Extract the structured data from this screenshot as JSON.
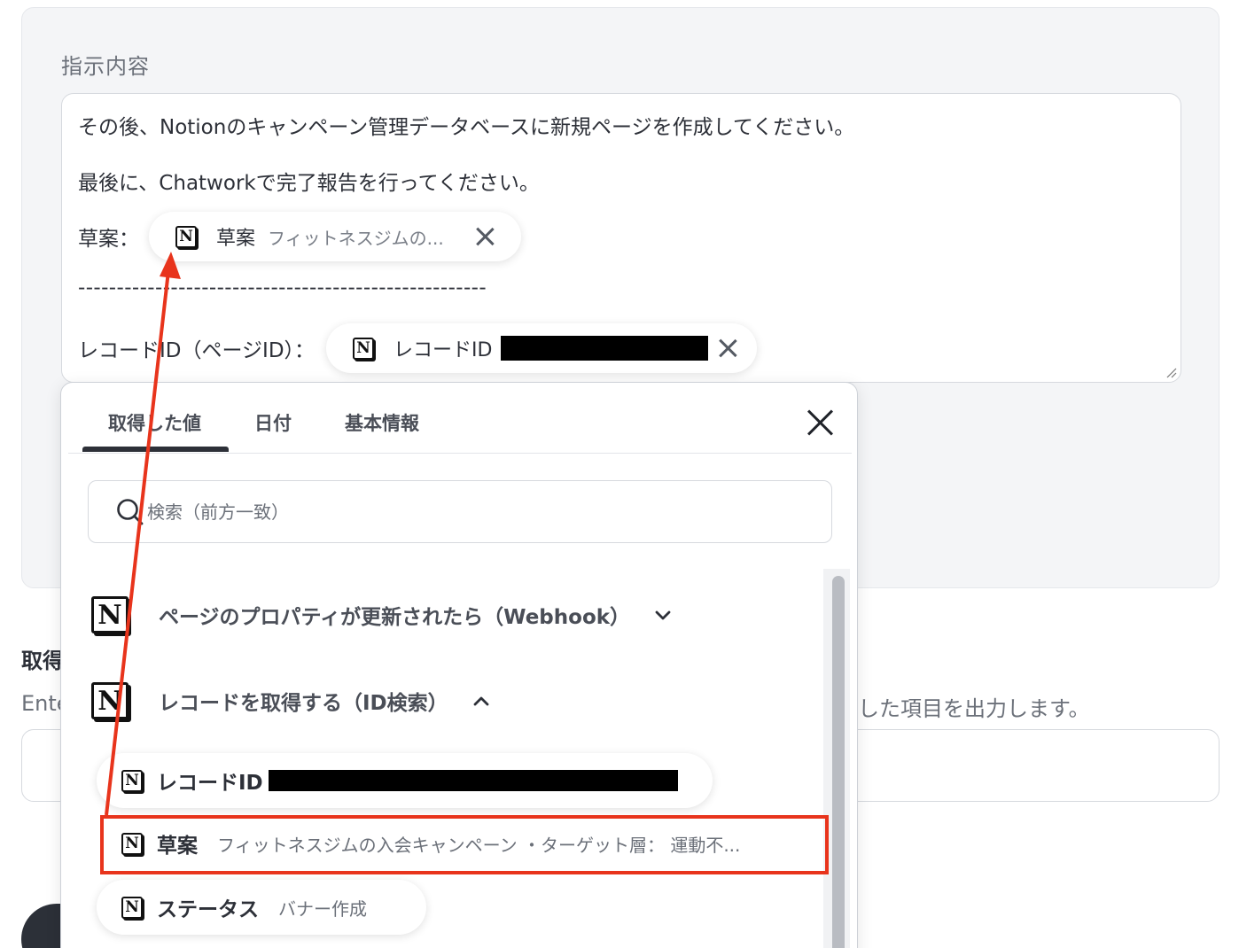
{
  "instruction": {
    "label": "指示内容",
    "lines": {
      "notion": "その後、Notionのキャンペーン管理データベースに新規ページを作成してください。",
      "chatwork": "最後に、Chatworkで完了報告を行ってください。",
      "draft_label": "草案：",
      "divider": "-----------------------------------------------------",
      "record_label": "レコードID（ページID）："
    },
    "chips": {
      "draft": {
        "title": "草案",
        "value": "フィットネスジムの..."
      },
      "record": {
        "title": "レコードID"
      }
    }
  },
  "background": {
    "title_visible": "取得",
    "desc_left_visible": "Ente",
    "desc_right_visible": "した項目を出力します。"
  },
  "popover": {
    "tabs": [
      "取得した値",
      "日付",
      "基本情報"
    ],
    "active_tab": "取得した値",
    "search": {
      "placeholder": "検索（前方一致）"
    },
    "sections": [
      {
        "label": "ページのプロパティが更新されたら（Webhook）",
        "expanded": false,
        "icon": "chevron-down-icon"
      },
      {
        "label": "レコードを取得する（ID検索）",
        "expanded": true,
        "icon": "chevron-up-icon"
      }
    ],
    "items": [
      {
        "title": "レコードID",
        "value": ""
      },
      {
        "title": "草案",
        "value": "フィットネスジムの入会キャンペーン ・ターゲット層： 運動不..."
      },
      {
        "title": "ステータス",
        "value": "バナー作成"
      }
    ]
  },
  "colors": {
    "annotation_red": "#e8341c",
    "panel_bg": "#f4f5f7",
    "text_dark": "#2d3038"
  },
  "icons": {
    "notion": "notion-logo-icon",
    "close": "close-icon",
    "search": "search-icon"
  }
}
